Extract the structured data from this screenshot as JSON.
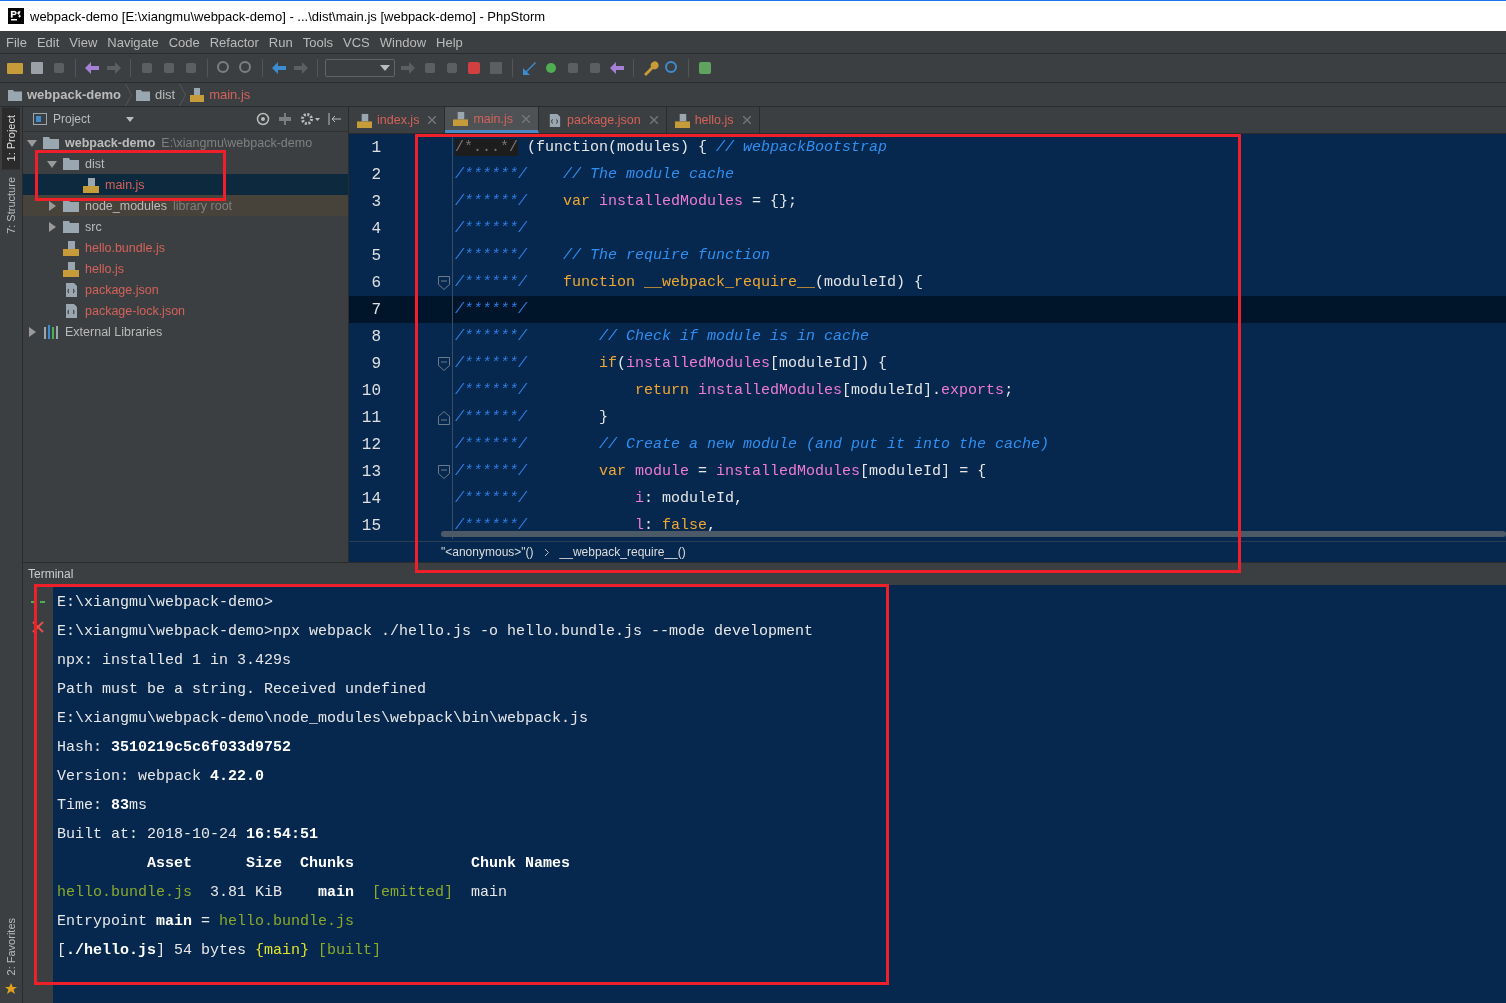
{
  "window": {
    "title": "webpack-demo [E:\\xiangmu\\webpack-demo] - ...\\dist\\main.js [webpack-demo] - PhpStorm"
  },
  "menu": [
    "File",
    "Edit",
    "View",
    "Navigate",
    "Code",
    "Refactor",
    "Run",
    "Tools",
    "VCS",
    "Window",
    "Help"
  ],
  "breadcrumb": [
    {
      "label": "webpack-demo",
      "kind": "project"
    },
    {
      "label": "dist",
      "kind": "folder"
    },
    {
      "label": "main.js",
      "kind": "js"
    }
  ],
  "tool_strip": {
    "top": [
      {
        "label": "1: Project",
        "selected": true
      },
      {
        "label": "7: Structure",
        "selected": false
      }
    ],
    "bottom": [
      {
        "label": "2: Favorites",
        "selected": false
      }
    ]
  },
  "project": {
    "title": "Project",
    "tree": [
      {
        "label": "webpack-demo",
        "kind": "project",
        "note": "E:\\xiangmu\\webpack-demo",
        "expanded": true,
        "unversioned": false,
        "selected": false,
        "children": [
          {
            "label": "dist",
            "kind": "folder",
            "expanded": true,
            "unversioned": false,
            "selected": false,
            "children": [
              {
                "label": "main.js",
                "kind": "js",
                "unversioned": true,
                "selected": true
              }
            ]
          },
          {
            "label": "node_modules",
            "kind": "library",
            "note": "library root",
            "expanded": false,
            "unversioned": false,
            "selected": false
          },
          {
            "label": "src",
            "kind": "folder",
            "expanded": false,
            "unversioned": false,
            "selected": false
          },
          {
            "label": "hello.bundle.js",
            "kind": "js",
            "unversioned": true,
            "selected": false
          },
          {
            "label": "hello.js",
            "kind": "js",
            "unversioned": true,
            "selected": false
          },
          {
            "label": "package.json",
            "kind": "json",
            "unversioned": true,
            "selected": false
          },
          {
            "label": "package-lock.json",
            "kind": "json",
            "unversioned": true,
            "selected": false
          }
        ]
      },
      {
        "label": "External Libraries",
        "kind": "libs",
        "expanded": false,
        "unversioned": false,
        "selected": false
      }
    ]
  },
  "tabs": [
    {
      "label": "index.js",
      "kind": "js",
      "selected": false
    },
    {
      "label": "main.js",
      "kind": "js",
      "selected": true
    },
    {
      "label": "package.json",
      "kind": "json",
      "selected": false
    },
    {
      "label": "hello.js",
      "kind": "js",
      "selected": false
    }
  ],
  "editor": {
    "lines": [
      {
        "number": "1",
        "current": false,
        "kind": "plain",
        "segments": [
          {
            "text": "/*...*/",
            "kind": "folded"
          },
          {
            "text": " (function(modules) { ",
            "kind": "plain"
          },
          {
            "text": "// webpackBootstrap",
            "kind": "comment"
          }
        ]
      },
      {
        "number": "2",
        "current": false,
        "kind": "plain",
        "segments": [
          {
            "text": "/******/",
            "kind": "prefix"
          },
          {
            "text": "    // The module cache",
            "kind": "comment"
          }
        ]
      },
      {
        "number": "3",
        "current": false,
        "kind": "plain",
        "segments": [
          {
            "text": "/******/",
            "kind": "prefix"
          },
          {
            "text": "    var",
            "kind": "keyword"
          },
          {
            "text": " installedModules",
            "kind": "ident"
          },
          {
            "text": " = {};",
            "kind": "plain"
          }
        ]
      },
      {
        "number": "4",
        "current": false,
        "kind": "plain",
        "segments": [
          {
            "text": "/******/",
            "kind": "prefix"
          }
        ]
      },
      {
        "number": "5",
        "current": false,
        "kind": "plain",
        "segments": [
          {
            "text": "/******/",
            "kind": "prefix"
          },
          {
            "text": "    // The require function",
            "kind": "comment"
          }
        ]
      },
      {
        "number": "6",
        "current": false,
        "kind": "open",
        "segments": [
          {
            "text": "/******/",
            "kind": "prefix"
          },
          {
            "text": "    function",
            "kind": "keyword"
          },
          {
            "text": " __webpack_require__",
            "kind": "keyword"
          },
          {
            "text": "(moduleId) {",
            "kind": "plain"
          }
        ]
      },
      {
        "number": "7",
        "current": true,
        "kind": "plain",
        "segments": [
          {
            "text": "/******/",
            "kind": "prefix"
          }
        ]
      },
      {
        "number": "8",
        "current": false,
        "kind": "plain",
        "segments": [
          {
            "text": "/******/",
            "kind": "prefix"
          },
          {
            "text": "        // Check if module is in cache",
            "kind": "comment"
          }
        ]
      },
      {
        "number": "9",
        "current": false,
        "kind": "open",
        "segments": [
          {
            "text": "/******/",
            "kind": "prefix"
          },
          {
            "text": "        if",
            "kind": "keyword"
          },
          {
            "text": "(",
            "kind": "plain"
          },
          {
            "text": "installedModules",
            "kind": "ident"
          },
          {
            "text": "[moduleId]) {",
            "kind": "plain"
          }
        ]
      },
      {
        "number": "10",
        "current": false,
        "kind": "plain",
        "segments": [
          {
            "text": "/******/",
            "kind": "prefix"
          },
          {
            "text": "            return",
            "kind": "keyword"
          },
          {
            "text": " installedModules",
            "kind": "ident"
          },
          {
            "text": "[moduleId].",
            "kind": "plain"
          },
          {
            "text": "exports",
            "kind": "ident"
          },
          {
            "text": ";",
            "kind": "plain"
          }
        ]
      },
      {
        "number": "11",
        "current": false,
        "kind": "close",
        "segments": [
          {
            "text": "/******/",
            "kind": "prefix"
          },
          {
            "text": "        }",
            "kind": "plain"
          }
        ]
      },
      {
        "number": "12",
        "current": false,
        "kind": "plain",
        "segments": [
          {
            "text": "/******/",
            "kind": "prefix"
          },
          {
            "text": "        // Create a new module (and put it into the cache)",
            "kind": "comment"
          }
        ]
      },
      {
        "number": "13",
        "current": false,
        "kind": "open",
        "segments": [
          {
            "text": "/******/",
            "kind": "prefix"
          },
          {
            "text": "        var",
            "kind": "keyword"
          },
          {
            "text": " module",
            "kind": "ident"
          },
          {
            "text": " = ",
            "kind": "plain"
          },
          {
            "text": "installedModules",
            "kind": "ident"
          },
          {
            "text": "[moduleId] = {",
            "kind": "plain"
          }
        ]
      },
      {
        "number": "14",
        "current": false,
        "kind": "plain",
        "segments": [
          {
            "text": "/******/",
            "kind": "prefix"
          },
          {
            "text": "            i",
            "kind": "ident"
          },
          {
            "text": ": moduleId,",
            "kind": "plain"
          }
        ]
      },
      {
        "number": "15",
        "current": false,
        "kind": "plain",
        "segments": [
          {
            "text": "/******/",
            "kind": "prefix"
          },
          {
            "text": "            l",
            "kind": "ident"
          },
          {
            "text": ": ",
            "kind": "plain"
          },
          {
            "text": "false",
            "kind": "keyword"
          },
          {
            "text": ",",
            "kind": "plain"
          }
        ]
      }
    ],
    "breadcrumb": [
      "\"<anonymous>\"()",
      "__webpack_require__()"
    ]
  },
  "terminal": {
    "title": "Terminal",
    "lines": [
      [
        {
          "text": "E:\\xiangmu\\webpack-demo>",
          "kind": "plain"
        }
      ],
      [
        {
          "text": "E:\\xiangmu\\webpack-demo>npx webpack ./hello.js -o hello.bundle.js --mode development",
          "kind": "plain"
        }
      ],
      [
        {
          "text": "npx: installed 1 in 3.429s",
          "kind": "plain"
        }
      ],
      [
        {
          "text": "Path must be a string. Received undefined",
          "kind": "plain"
        }
      ],
      [
        {
          "text": "E:\\xiangmu\\webpack-demo\\node_modules\\webpack\\bin\\webpack.js",
          "kind": "plain"
        }
      ],
      [
        {
          "text": "Hash: ",
          "kind": "plain"
        },
        {
          "text": "3510219c5c6f033d9752",
          "kind": "bold"
        }
      ],
      [
        {
          "text": "Version: webpack ",
          "kind": "plain"
        },
        {
          "text": "4.22.0",
          "kind": "bold"
        }
      ],
      [
        {
          "text": "Time: ",
          "kind": "plain"
        },
        {
          "text": "83",
          "kind": "bold"
        },
        {
          "text": "ms",
          "kind": "plain"
        }
      ],
      [
        {
          "text": "Built at: 2018-10-24 ",
          "kind": "plain"
        },
        {
          "text": "16:54:51",
          "kind": "bold"
        }
      ],
      [
        {
          "text": "          Asset      Size  Chunks             Chunk Names",
          "kind": "bold"
        }
      ],
      [
        {
          "text": "hello.bundle.js",
          "kind": "green"
        },
        {
          "text": "  3.81 KiB    ",
          "kind": "plain"
        },
        {
          "text": "main",
          "kind": "bold"
        },
        {
          "text": "  [emitted]",
          "kind": "green"
        },
        {
          "text": "  main",
          "kind": "plain"
        }
      ],
      [
        {
          "text": "Entrypoint ",
          "kind": "plain"
        },
        {
          "text": "main",
          "kind": "bold"
        },
        {
          "text": " = ",
          "kind": "plain"
        },
        {
          "text": "hello.bundle.js",
          "kind": "green"
        }
      ],
      [
        {
          "text": "[",
          "kind": "plain"
        },
        {
          "text": "./hello.js",
          "kind": "bold"
        },
        {
          "text": "] 54 bytes ",
          "kind": "plain"
        },
        {
          "text": "{main}",
          "kind": "yellow"
        },
        {
          "text": " [built]",
          "kind": "green"
        }
      ]
    ]
  }
}
